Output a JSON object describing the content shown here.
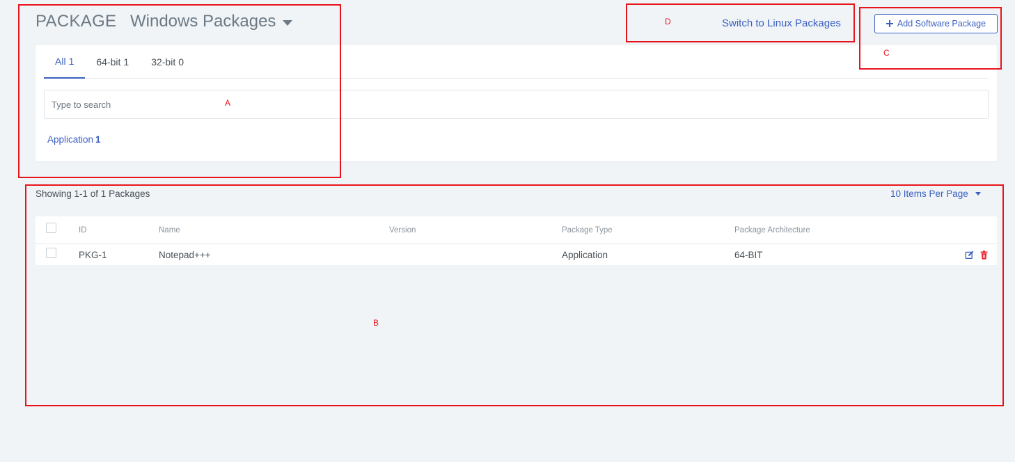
{
  "header": {
    "title": "PACKAGE",
    "subtitle": "Windows Packages",
    "switch_link": "Switch to Linux Packages",
    "add_button": "Add Software Package"
  },
  "tabs": [
    {
      "label": "All",
      "count": "1"
    },
    {
      "label": "64-bit",
      "count": "1"
    },
    {
      "label": "32-bit",
      "count": "0"
    }
  ],
  "search": {
    "placeholder": "Type to search",
    "value": ""
  },
  "filter_chip": {
    "label": "Application",
    "count": "1"
  },
  "list": {
    "showing": "Showing 1-1 of 1 Packages",
    "per_page": "10 Items Per Page",
    "columns": [
      "ID",
      "Name",
      "Version",
      "Package Type",
      "Package Architecture"
    ],
    "rows": [
      {
        "id": "PKG-1",
        "name": "Notepad+++",
        "version": "",
        "type": "Application",
        "arch": "64-BIT"
      }
    ]
  },
  "annotations": [
    "A",
    "B",
    "C",
    "D"
  ],
  "colors": {
    "accent": "#3b5fc0",
    "annotation": "#e8141b",
    "background": "#f0f4f7",
    "delete": "#e8141b"
  }
}
